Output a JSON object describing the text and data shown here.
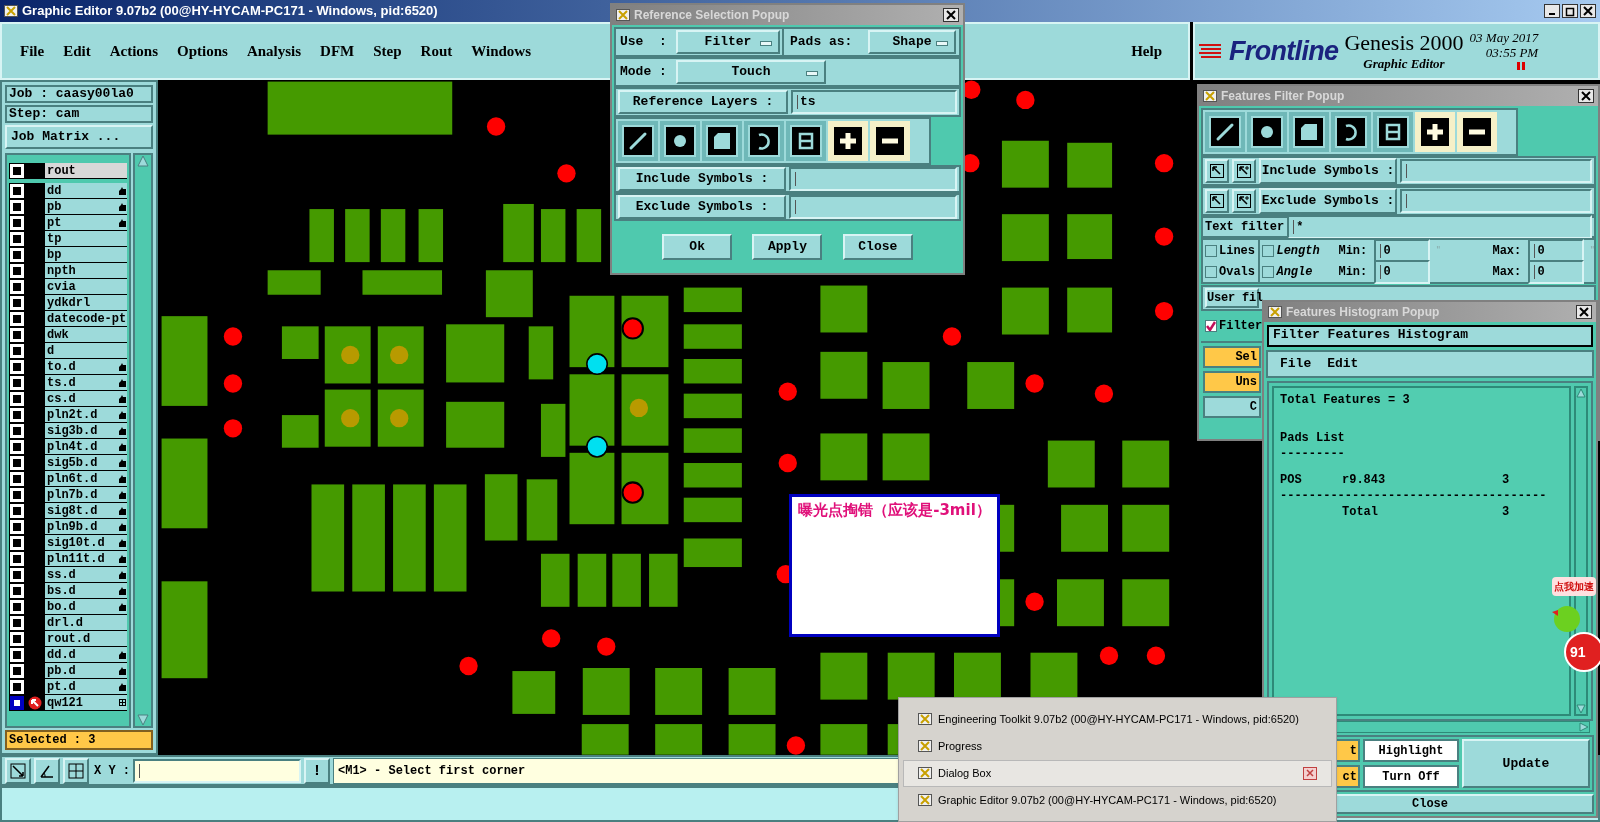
{
  "window": {
    "title": "Graphic Editor 9.07b2 (00@HY-HYCAM-PC171 - Windows, pid:6520)"
  },
  "menu": [
    {
      "label": "File"
    },
    {
      "label": "Edit"
    },
    {
      "label": "Actions"
    },
    {
      "label": "Options"
    },
    {
      "label": "Analysis"
    },
    {
      "label": "DFM"
    },
    {
      "label": "Step"
    },
    {
      "label": "Rout"
    },
    {
      "label": "Windows"
    }
  ],
  "help": "Help",
  "brand": {
    "logo": "Frontline",
    "product": "Genesis 2000",
    "subtitle": "Graphic Editor",
    "date": "03 May 2017",
    "time": "03:55 PM"
  },
  "job_panel": {
    "job": "Job : caasy00la0",
    "step": "Step: cam",
    "matrix_button": "Job Matrix ...",
    "selected_count": "Selected : 3",
    "layers": [
      {
        "name": "rout",
        "kind": "board",
        "marked": false,
        "selected": false
      },
      {
        "name": "dd",
        "kind": "layer",
        "marked": true,
        "selected": false
      },
      {
        "name": "pb",
        "kind": "layer",
        "marked": true,
        "selected": false
      },
      {
        "name": "pt",
        "kind": "layer",
        "marked": true,
        "selected": false
      },
      {
        "name": "tp",
        "kind": "layer",
        "marked": false,
        "selected": false
      },
      {
        "name": "bp",
        "kind": "layer",
        "marked": false,
        "selected": false
      },
      {
        "name": "npth",
        "kind": "layer",
        "marked": false,
        "selected": false
      },
      {
        "name": "cvia",
        "kind": "layer",
        "marked": false,
        "selected": false
      },
      {
        "name": "ydkdrl",
        "kind": "layer",
        "marked": false,
        "selected": false
      },
      {
        "name": "datecode-pt",
        "kind": "layer",
        "marked": false,
        "selected": false
      },
      {
        "name": "dwk",
        "kind": "layer",
        "marked": false,
        "selected": false
      },
      {
        "name": "d",
        "kind": "layer",
        "marked": false,
        "selected": false
      },
      {
        "name": "to.d",
        "kind": "layer",
        "marked": true,
        "selected": false
      },
      {
        "name": "ts.d",
        "kind": "layer",
        "marked": true,
        "selected": false
      },
      {
        "name": "cs.d",
        "kind": "layer",
        "marked": true,
        "selected": false
      },
      {
        "name": "pln2t.d",
        "kind": "layer",
        "marked": true,
        "selected": false
      },
      {
        "name": "sig3b.d",
        "kind": "layer",
        "marked": true,
        "selected": false
      },
      {
        "name": "pln4t.d",
        "kind": "layer",
        "marked": true,
        "selected": false
      },
      {
        "name": "sig5b.d",
        "kind": "layer",
        "marked": true,
        "selected": false
      },
      {
        "name": "pln6t.d",
        "kind": "layer",
        "marked": true,
        "selected": false
      },
      {
        "name": "pln7b.d",
        "kind": "layer",
        "marked": true,
        "selected": false
      },
      {
        "name": "sig8t.d",
        "kind": "layer",
        "marked": true,
        "selected": false
      },
      {
        "name": "pln9b.d",
        "kind": "layer",
        "marked": true,
        "selected": false
      },
      {
        "name": "sig10t.d",
        "kind": "layer",
        "marked": true,
        "selected": false
      },
      {
        "name": "pln11t.d",
        "kind": "layer",
        "marked": true,
        "selected": false
      },
      {
        "name": "ss.d",
        "kind": "layer",
        "marked": true,
        "selected": false
      },
      {
        "name": "bs.d",
        "kind": "layer",
        "marked": true,
        "selected": false
      },
      {
        "name": "bo.d",
        "kind": "layer",
        "marked": true,
        "selected": false
      },
      {
        "name": "drl.d",
        "kind": "layer",
        "marked": false,
        "selected": false
      },
      {
        "name": "rout.d",
        "kind": "layer",
        "marked": false,
        "selected": false
      },
      {
        "name": "dd.d",
        "kind": "layer",
        "marked": true,
        "selected": false
      },
      {
        "name": "pb.d",
        "kind": "layer",
        "marked": true,
        "selected": false
      },
      {
        "name": "pt.d",
        "kind": "layer",
        "marked": true,
        "selected": false
      },
      {
        "name": "qw121",
        "kind": "work",
        "marked": false,
        "selected": true
      }
    ]
  },
  "bottom_bar": {
    "xy_label": "X Y :",
    "alert": "!",
    "hint": "<M1> - Select first corner"
  },
  "reference_popup": {
    "title": "Reference Selection Popup",
    "use_label": "Use  :",
    "use_value": "Filter",
    "pads_label": "Pads as:",
    "pads_value": "Shape",
    "mode_label": "Mode :",
    "mode_value": "Touch",
    "ref_layers_button": "Reference Layers :",
    "ref_layers_value": "ts",
    "feature_types": [
      {
        "kind": "line"
      },
      {
        "kind": "pad"
      },
      {
        "kind": "surface"
      },
      {
        "kind": "arc"
      },
      {
        "kind": "text"
      },
      {
        "kind": "plus"
      },
      {
        "kind": "minus"
      }
    ],
    "include_button": "Include Symbols :",
    "exclude_button": "Exclude Symbols :",
    "buttons": [
      "Ok",
      "Apply",
      "Close"
    ]
  },
  "filter_popup": {
    "title": "Features Filter Popup",
    "feature_types": [
      {
        "kind": "line"
      },
      {
        "kind": "pad"
      },
      {
        "kind": "surface"
      },
      {
        "kind": "arc"
      },
      {
        "kind": "text"
      },
      {
        "kind": "plus"
      },
      {
        "kind": "minus"
      }
    ],
    "include_button": "Include Symbols :",
    "exclude_button": "Exclude Symbols :",
    "text_filter_label": "Text filter",
    "text_filter_value": "*",
    "types": [
      {
        "label": "Lines",
        "checked": false
      },
      {
        "label": "Ovals",
        "checked": false
      }
    ],
    "ranges": [
      {
        "label": "Length",
        "checked": false,
        "disabled": true,
        "min_label": "Min:",
        "min": "0",
        "min_unit": "\"",
        "max_label": "Max:",
        "max": "0",
        "max_unit": "\""
      },
      {
        "label": "Angle",
        "checked": false,
        "disabled": true,
        "min_label": "Min:",
        "min": "0",
        "max_label": "Max:",
        "max": "0"
      }
    ],
    "user_filter_button": "User fil",
    "filter_toggle": {
      "label": "Filter",
      "checked": true
    },
    "side_buttons": [
      {
        "label": "Sel",
        "kind": "orange"
      },
      {
        "label": "Uns",
        "kind": "orange"
      },
      {
        "label": "C",
        "kind": "plain"
      }
    ]
  },
  "histogram_popup": {
    "title": "Features Histogram Popup",
    "heading": "Filter Features Histogram",
    "menu": [
      "File",
      "Edit"
    ],
    "total_line": "Total Features = 3",
    "section": "Pads List",
    "section_rule": "---------",
    "rows": [
      {
        "type": "POS",
        "symbol": "r9.843",
        "count": "3"
      }
    ],
    "total_rule": "-------------------------------------",
    "total": {
      "label": "Total",
      "count": "3"
    },
    "buttons": [
      {
        "label": "t",
        "kind": "orange"
      },
      {
        "label": "Highlight",
        "kind": "white"
      },
      {
        "label": "ct",
        "kind": "orange"
      },
      {
        "label": "Turn Off",
        "kind": "white"
      }
    ],
    "update": "Update",
    "close": "Close"
  },
  "taskbar_menu": [
    {
      "label": "Engineering Toolkit 9.07b2 (00@HY-HYCAM-PC171 - Windows, pid:6520)",
      "selected": false
    },
    {
      "label": "Progress",
      "selected": false
    },
    {
      "label": "Dialog Box",
      "selected": true
    },
    {
      "label": "Graphic Editor 9.07b2 (00@HY-HYCAM-PC171 - Windows, pid:6520)",
      "selected": false
    }
  ],
  "annotation": {
    "text": "曝光点掏错（应该是-3mil）"
  },
  "widget": {
    "label": "点我加速",
    "count": "91"
  }
}
